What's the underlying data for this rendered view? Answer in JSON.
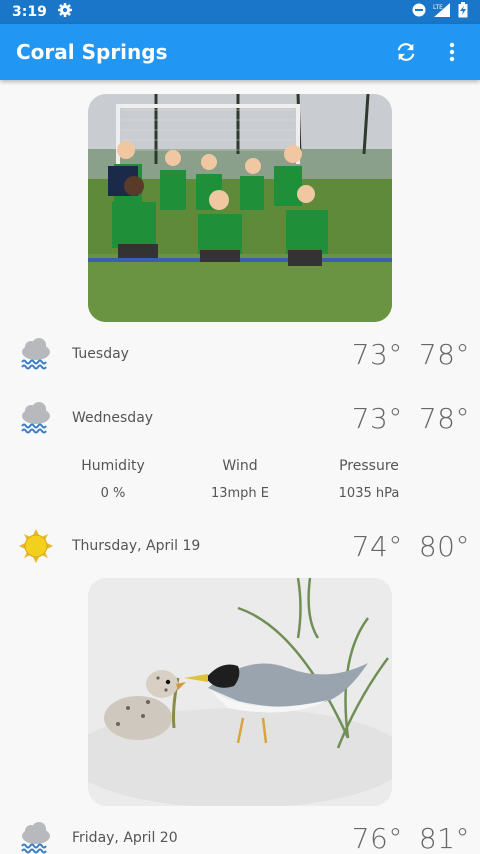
{
  "status_bar": {
    "time": "3:19",
    "network": "LTE"
  },
  "app_bar": {
    "title": "Coral Springs"
  },
  "forecast": [
    {
      "day": "Tuesday",
      "icon": "rain-cloud-icon",
      "low": "73°",
      "high": "78°"
    },
    {
      "day": "Wednesday",
      "icon": "rain-cloud-icon",
      "low": "73°",
      "high": "78°"
    },
    {
      "day": "Thursday, April 19",
      "icon": "sun-icon",
      "low": "74°",
      "high": "80°"
    },
    {
      "day": "Friday, April 20",
      "icon": "rain-cloud-icon",
      "low": "76°",
      "high": "81°"
    }
  ],
  "details": {
    "humidity_label": "Humidity",
    "humidity_value": "0 %",
    "wind_label": "Wind",
    "wind_value": "13mph E",
    "pressure_label": "Pressure",
    "pressure_value": "1035 hPa"
  },
  "colors": {
    "status_bar": "#1976c8",
    "app_bar": "#2196f3",
    "background": "#f8f8f8"
  }
}
